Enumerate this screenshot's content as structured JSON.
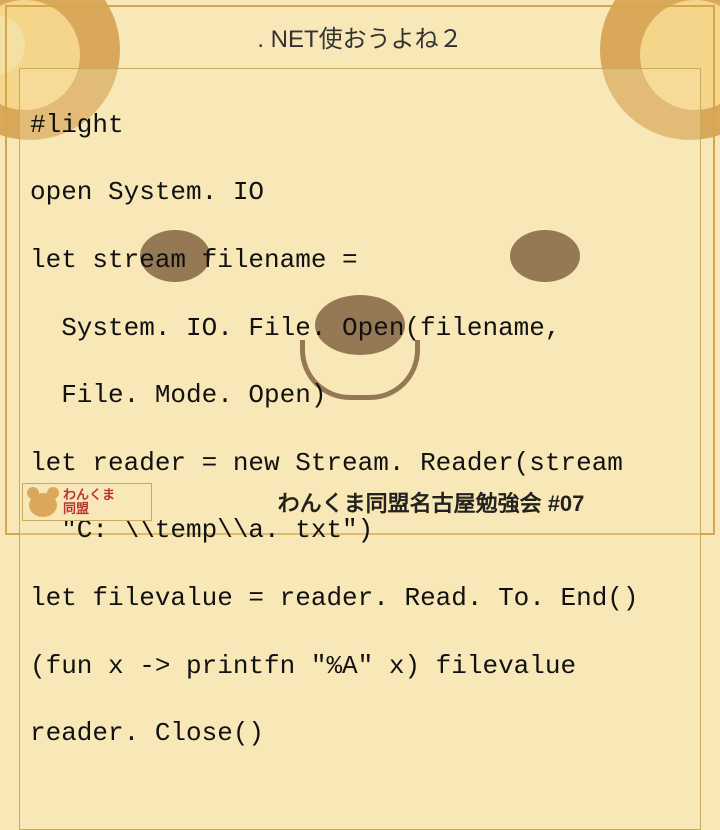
{
  "title": ". NET使おうよね２",
  "code": {
    "l1": "#light",
    "l2": "open System. IO",
    "l3": "let stream filename =",
    "l4": "System. IO. File. Open(filename,",
    "l5": "File. Mode. Open)",
    "l6": "let reader = new Stream. Reader(stream",
    "l7": "\"C: \\\\temp\\\\a. txt\")",
    "l8": "let filevalue = reader. Read. To. End()",
    "l9": "(fun x -> printfn \"%A\" x) filevalue",
    "l10": "reader. Close()"
  },
  "logo": {
    "line1": "わんくま",
    "line2": "同盟"
  },
  "footer": "わんくま同盟名古屋勉強会 #07"
}
